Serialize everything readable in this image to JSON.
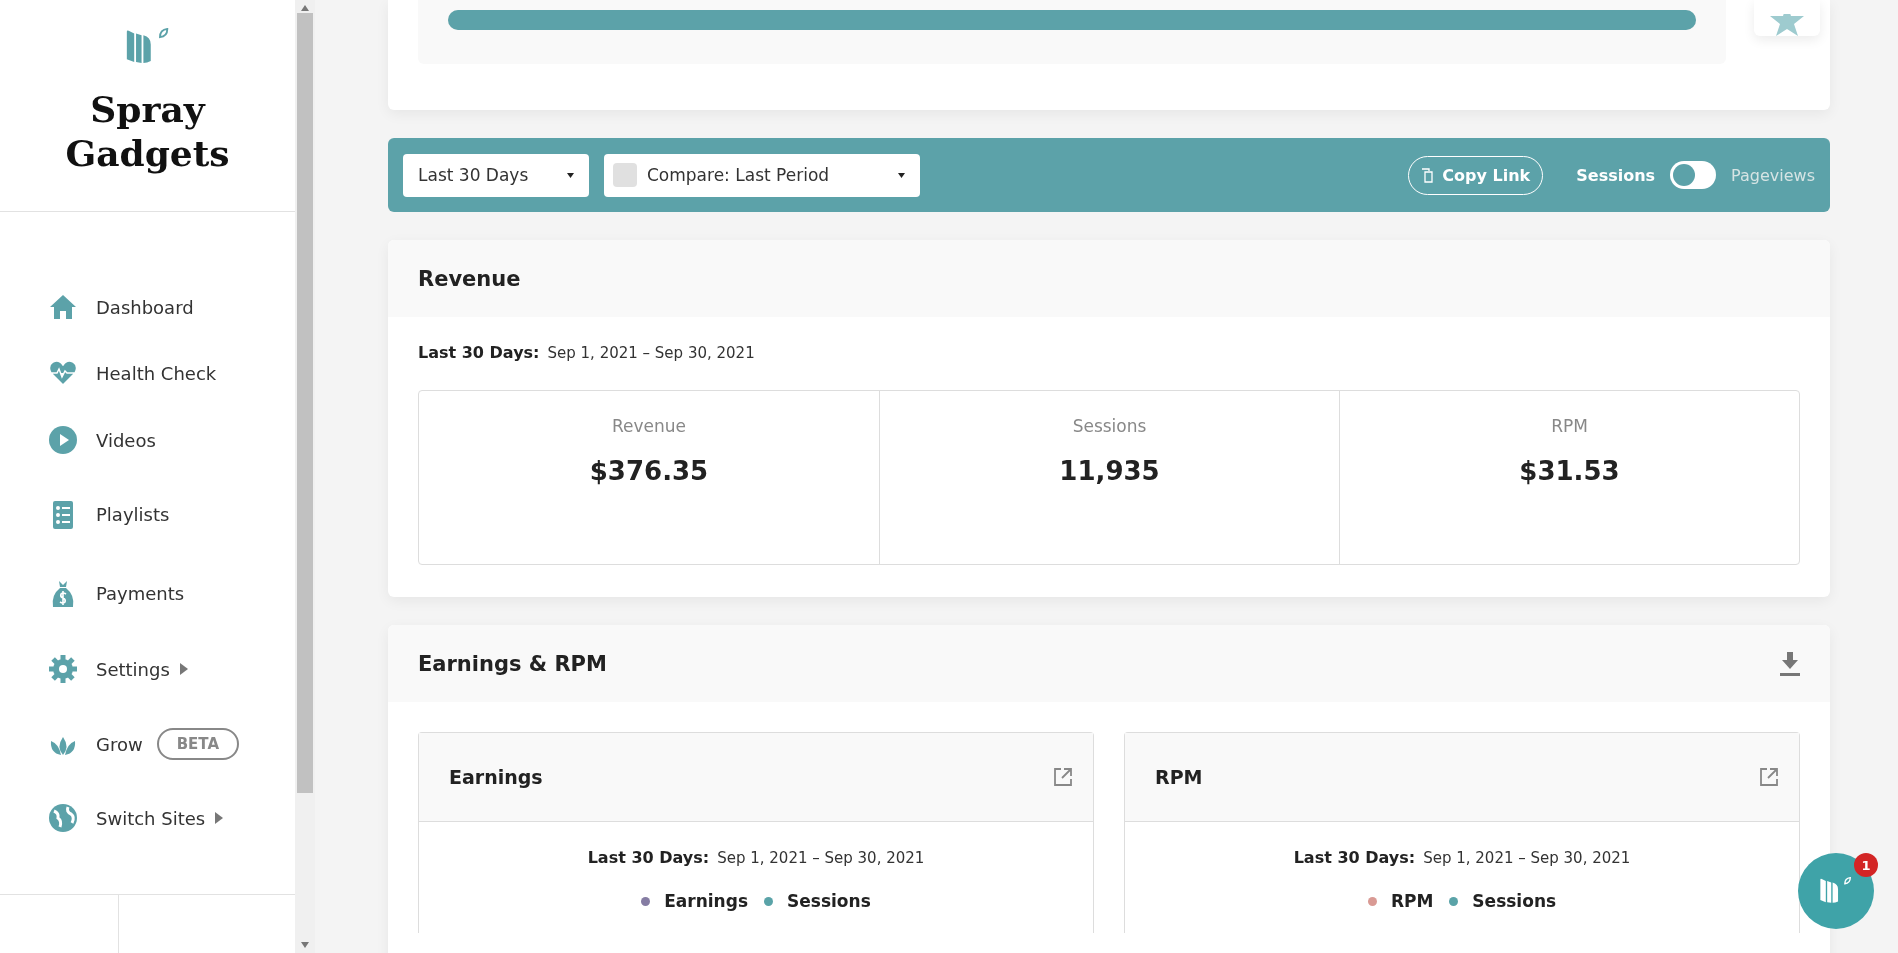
{
  "sidebar": {
    "site_name": "Spray Gadgets",
    "items": [
      {
        "label": "Dashboard",
        "submenu": false
      },
      {
        "label": "Health Check",
        "submenu": false
      },
      {
        "label": "Videos",
        "submenu": false
      },
      {
        "label": "Playlists",
        "submenu": false
      },
      {
        "label": "Payments",
        "submenu": false
      },
      {
        "label": "Settings",
        "submenu": true
      },
      {
        "label": "Grow",
        "submenu": false,
        "badge": "BETA"
      },
      {
        "label": "Switch Sites",
        "submenu": true
      }
    ]
  },
  "top_card": {
    "progress": {
      "level": 1
    }
  },
  "toolbar": {
    "range": "Last 30 Days",
    "compare": {
      "label": "Compare: Last Period",
      "checked": false
    },
    "copy_link": "Copy Link",
    "metric_toggle": [
      {
        "label": "Sessions",
        "selected": true
      },
      {
        "label": "Pageviews",
        "selected": false
      }
    ]
  },
  "revenue_card": {
    "title": "Revenue",
    "period_label": "Last 30 Days:",
    "period": "Sep 1, 2021 – Sep 30, 2021",
    "stats": [
      {
        "label": "Revenue",
        "value": "$376.35"
      },
      {
        "label": "Sessions",
        "value": "11,935"
      },
      {
        "label": "RPM",
        "value": "$31.53"
      }
    ]
  },
  "earnings_card": {
    "title": "Earnings & RPM",
    "panels": [
      {
        "title": "Earnings",
        "period_label": "Last 30 Days:",
        "period": "Sep 1, 2021 – Sep 30, 2021",
        "legend": [
          {
            "label": "Earnings",
            "color": "#857ca3"
          },
          {
            "label": "Sessions",
            "color": "#5aa3a8"
          }
        ]
      },
      {
        "title": "RPM",
        "period_label": "Last 30 Days:",
        "period": "Sep 1, 2021 – Sep 30, 2021",
        "legend": [
          {
            "label": "RPM",
            "color": "#d99a94"
          },
          {
            "label": "Sessions",
            "color": "#5aa3a8"
          }
        ]
      }
    ]
  },
  "chat": {
    "badge": "1"
  }
}
